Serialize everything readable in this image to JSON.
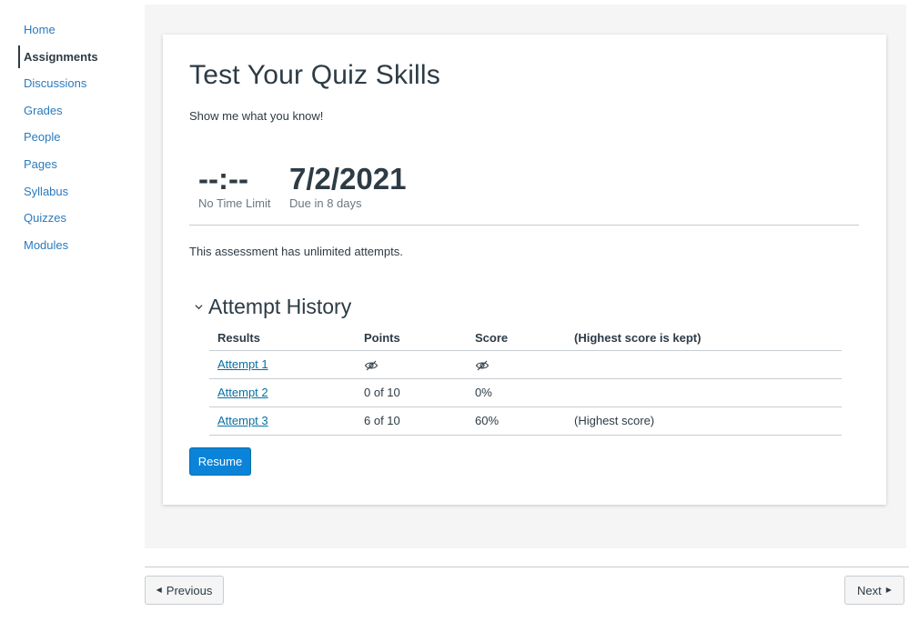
{
  "course_nav": {
    "items": [
      {
        "label": "Home"
      },
      {
        "label": "Assignments"
      },
      {
        "label": "Discussions"
      },
      {
        "label": "Grades"
      },
      {
        "label": "People"
      },
      {
        "label": "Pages"
      },
      {
        "label": "Syllabus"
      },
      {
        "label": "Quizzes"
      },
      {
        "label": "Modules"
      }
    ],
    "active": "Assignments"
  },
  "quiz": {
    "title": "Test Your Quiz Skills",
    "description": "Show me what you know!",
    "time_limit": {
      "value": "--:--",
      "label": "No Time Limit"
    },
    "due": {
      "value": "7/2/2021",
      "label": "Due in 8 days"
    },
    "attempts_info": "This assessment has unlimited attempts."
  },
  "attempt_history": {
    "title": "Attempt History",
    "expanded": true,
    "columns": [
      "Results",
      "Points",
      "Score",
      "(Highest score is kept)"
    ],
    "rows": [
      {
        "result": "Attempt 1",
        "points": "",
        "score": "",
        "note": "",
        "hidden": true
      },
      {
        "result": "Attempt 2",
        "points": "0 of 10",
        "score": "0%",
        "note": "",
        "hidden": false
      },
      {
        "result": "Attempt 3",
        "points": "6 of 10",
        "score": "60%",
        "note": "(Highest score)",
        "hidden": false
      }
    ]
  },
  "actions": {
    "resume_label": "Resume"
  },
  "footer": {
    "previous_label": "Previous",
    "next_label": "Next"
  },
  "colors": {
    "link": "#2b7abc",
    "primary_button": "#0b83d8",
    "text": "#2d3b45"
  },
  "icons": {
    "hidden_value": "eye-slash-icon",
    "expand": "chevron-down-icon",
    "prev": "triangle-left-icon",
    "next": "triangle-right-icon"
  }
}
